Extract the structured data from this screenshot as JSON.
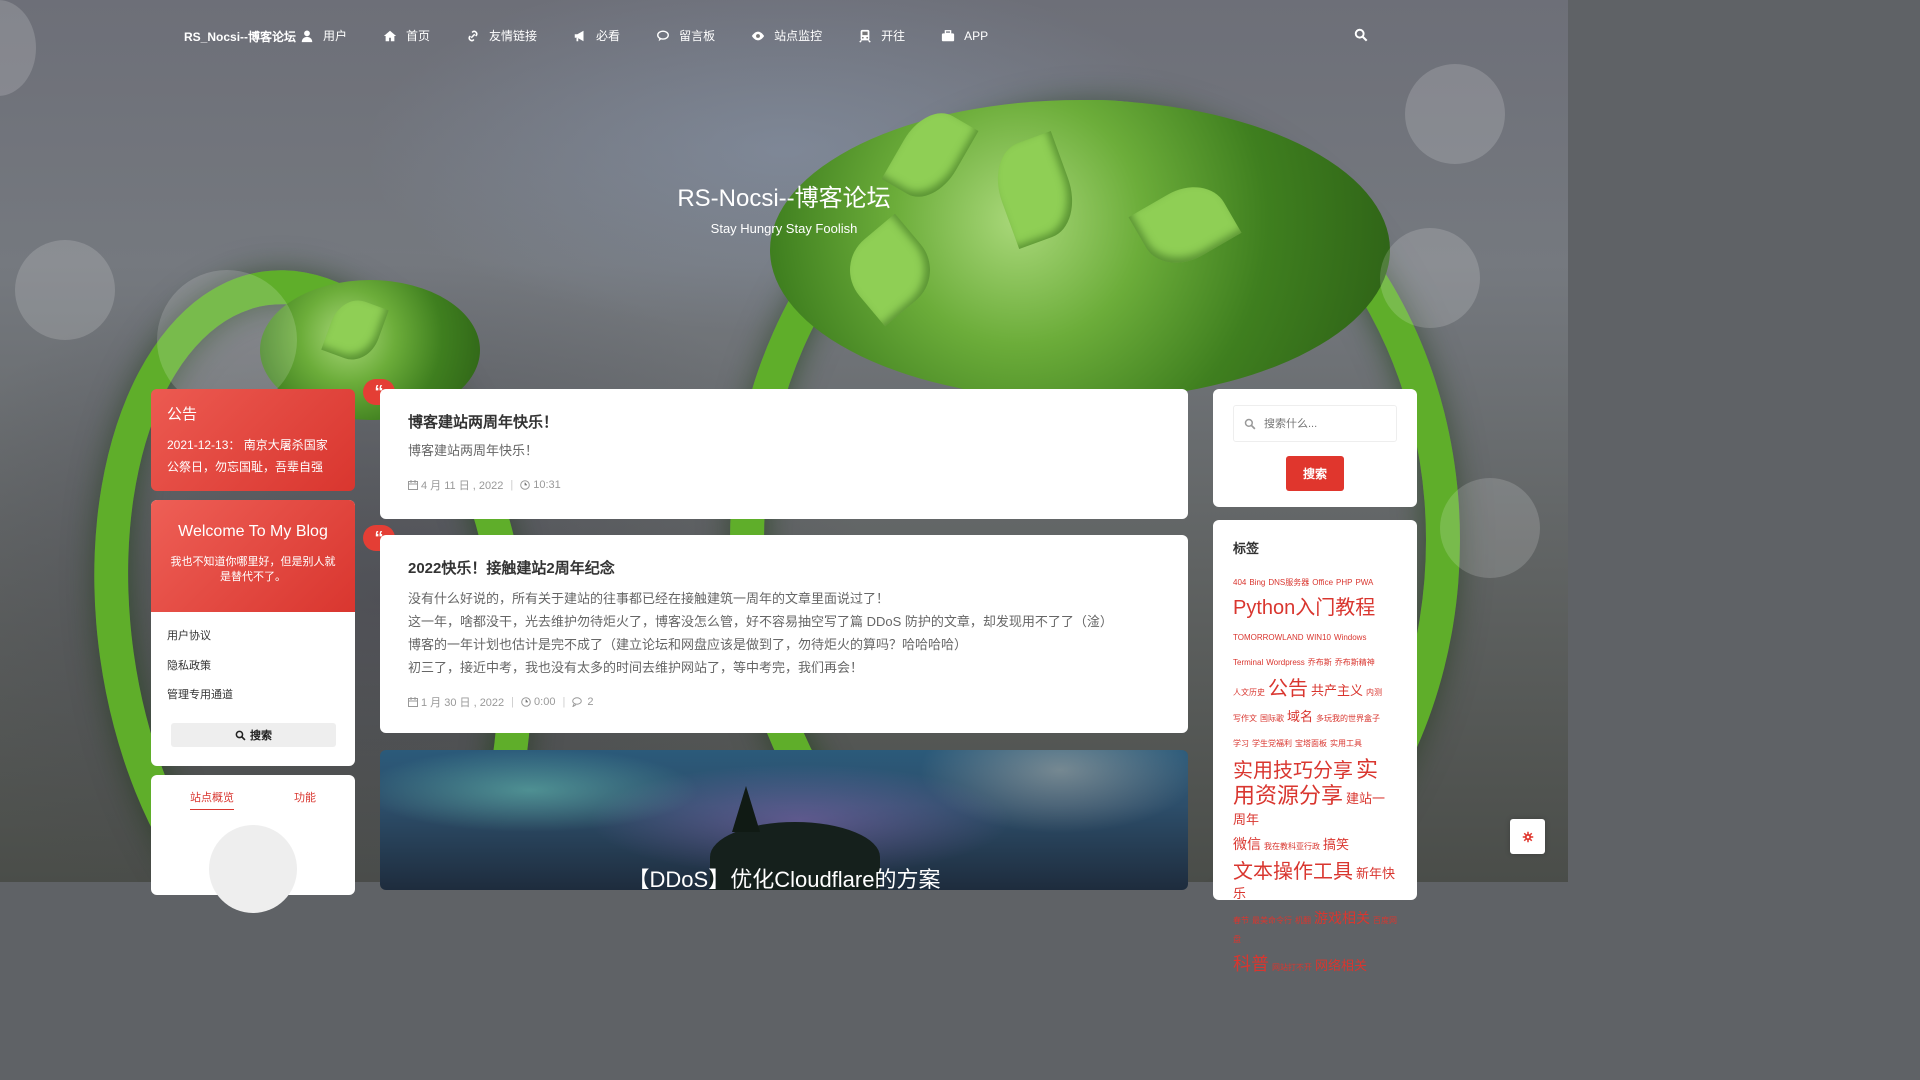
{
  "nav": {
    "brand": "RS_Nocsi--博客论坛",
    "items": [
      {
        "label": "用户",
        "icon": "user-icon"
      },
      {
        "label": "首页",
        "icon": "home-icon"
      },
      {
        "label": "友情链接",
        "icon": "link-icon"
      },
      {
        "label": "必看",
        "icon": "megaphone-icon"
      },
      {
        "label": "留言板",
        "icon": "comment-icon"
      },
      {
        "label": "站点监控",
        "icon": "eye-icon"
      },
      {
        "label": "开往",
        "icon": "train-icon"
      },
      {
        "label": "APP",
        "icon": "briefcase-icon"
      }
    ]
  },
  "hero": {
    "title": "RS-Nocsi--博客论坛",
    "subtitle": "Stay Hungry Stay Foolish"
  },
  "notice": {
    "heading": "公告",
    "text": "2021-12-13： 南京大屠杀国家公祭日，勿忘国耻，吾辈自强"
  },
  "welcome": {
    "heading": "Welcome To My Blog",
    "text": "我也不知道你哪里好，但是别人就是替代不了。",
    "links": [
      "用户协议",
      "隐私政策",
      "管理专用通道"
    ],
    "search_label": "搜索"
  },
  "stats": {
    "tab_overview": "站点概览",
    "tab_features": "功能"
  },
  "posts": [
    {
      "title": "博客建站两周年快乐！",
      "excerpt": [
        "博客建站两周年快乐！"
      ],
      "date": "4 月 11 日 , 2022",
      "time": "10:31"
    },
    {
      "title": "2022快乐！接触建站2周年纪念",
      "excerpt": [
        "没有什么好说的，所有关于建站的往事都已经在接触建筑一周年的文章里面说过了！",
        "这一年，啥都没干，光去维护勿待炬火了，博客没怎么管，好不容易抽空写了篇 DDoS 防护的文章，却发现用不了了（淦）",
        "博客的一年计划也估计是完不成了（建立论坛和网盘应该是做到了，勿待炬火的算吗？哈哈哈哈）",
        "初三了，接近中考，我也没有太多的时间去维护网站了，等中考完，我们再会！"
      ],
      "date": "1 月 30 日 , 2022",
      "time": "0:00",
      "comments": "2"
    },
    {
      "title": "【DDoS】优化Cloudflare的方案"
    }
  ],
  "search": {
    "placeholder": "搜索什么...",
    "button": "搜索"
  },
  "tags": {
    "heading": "标签",
    "lines": [
      [
        {
          "t": "404",
          "s": 9
        },
        {
          "t": "Bing",
          "s": 9
        },
        {
          "t": "DNS服务器",
          "s": 9
        },
        {
          "t": "Office",
          "s": 9
        },
        {
          "t": "PHP",
          "s": 9
        },
        {
          "t": "PWA",
          "s": 9
        }
      ],
      [
        {
          "t": "Python入门教程",
          "s": 20
        }
      ],
      [
        {
          "t": "TOMORROWLAND",
          "s": 9
        },
        {
          "t": "WIN10",
          "s": 9
        },
        {
          "t": "Windows",
          "s": 9
        }
      ],
      [
        {
          "t": "Terminal",
          "s": 9
        },
        {
          "t": "Wordpress",
          "s": 9
        },
        {
          "t": "乔布斯",
          "s": 9
        },
        {
          "t": "乔布斯精神",
          "s": 9
        }
      ],
      [
        {
          "t": "人文历史",
          "s": 9
        },
        {
          "t": "公告",
          "s": 20
        },
        {
          "t": "共产主义",
          "s": 13
        },
        {
          "t": "内测",
          "s": 9
        }
      ],
      [
        {
          "t": "写作文",
          "s": 9
        },
        {
          "t": "国际歌",
          "s": 9
        },
        {
          "t": "域名",
          "s": 13
        },
        {
          "t": "多玩我的世界盒子",
          "s": 9
        }
      ],
      [
        {
          "t": "学习",
          "s": 9
        },
        {
          "t": "学生党福利",
          "s": 9
        },
        {
          "t": "宝塔面板",
          "s": 9
        },
        {
          "t": "实用工具",
          "s": 9
        }
      ],
      [
        {
          "t": "实用技巧分享",
          "s": 20
        },
        {
          "t": "实用资源分享",
          "s": 22
        },
        {
          "t": "建站一周年",
          "s": 13
        }
      ],
      [
        {
          "t": "微信",
          "s": 14
        },
        {
          "t": "我在教科亚行政",
          "s": 9
        },
        {
          "t": "搞笑",
          "s": 13
        }
      ],
      [
        {
          "t": "文本操作工具",
          "s": 20
        },
        {
          "t": "新年快乐",
          "s": 13
        }
      ],
      [
        {
          "t": "春节",
          "s": 9
        },
        {
          "t": "最美命令行",
          "s": 9
        },
        {
          "t": "机翻",
          "s": 9
        },
        {
          "t": "游戏相关",
          "s": 14
        },
        {
          "t": "百度网盘",
          "s": 9
        }
      ],
      [
        {
          "t": "科普",
          "s": 18
        },
        {
          "t": "网站打不开",
          "s": 9
        },
        {
          "t": "网络相关",
          "s": 13
        }
      ]
    ]
  },
  "colors": {
    "accent": "#d9362f",
    "card": "#ffffff",
    "text": "#333333"
  }
}
